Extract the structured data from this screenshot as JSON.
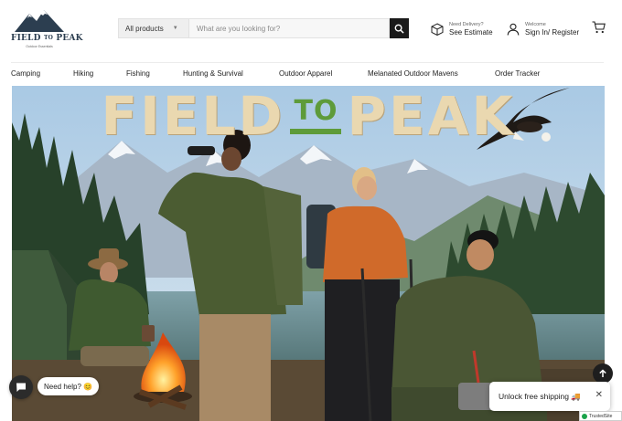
{
  "brand": {
    "name_left": "FIELD",
    "name_mid": "TO",
    "name_right": "PEAK",
    "tagline": "Outdoor Essentials"
  },
  "search": {
    "category_label": "All products",
    "placeholder": "What are you looking for?"
  },
  "header": {
    "delivery_small": "Need Delivery?",
    "delivery_big": "See Estimate",
    "account_small": "Welcome",
    "account_big": "Sign In/ Register"
  },
  "nav": {
    "items": [
      "Camping",
      "Hiking",
      "Fishing",
      "Hunting & Survival",
      "Outdoor Apparel",
      "Melanated Outdoor Mavens",
      "Order Tracker"
    ]
  },
  "hero": {
    "title_left": "FIELD",
    "title_mid": "TO",
    "title_right": "PEAK"
  },
  "widgets": {
    "chat_label": "Need help? 😊",
    "shipping_label": "Unlock free shipping 🚚",
    "shipping_close": "✕",
    "trusted_label": "TrustedSite"
  },
  "icons": [
    "mountain-logo-icon",
    "chevron-down-icon",
    "search-icon",
    "box-icon",
    "user-icon",
    "cart-icon",
    "chat-icon",
    "arrow-up-icon",
    "close-icon",
    "check-icon"
  ],
  "colors": {
    "accent_green": "#5e9b3a",
    "title_cream": "#ead8b0",
    "dark": "#1a1a1a"
  }
}
